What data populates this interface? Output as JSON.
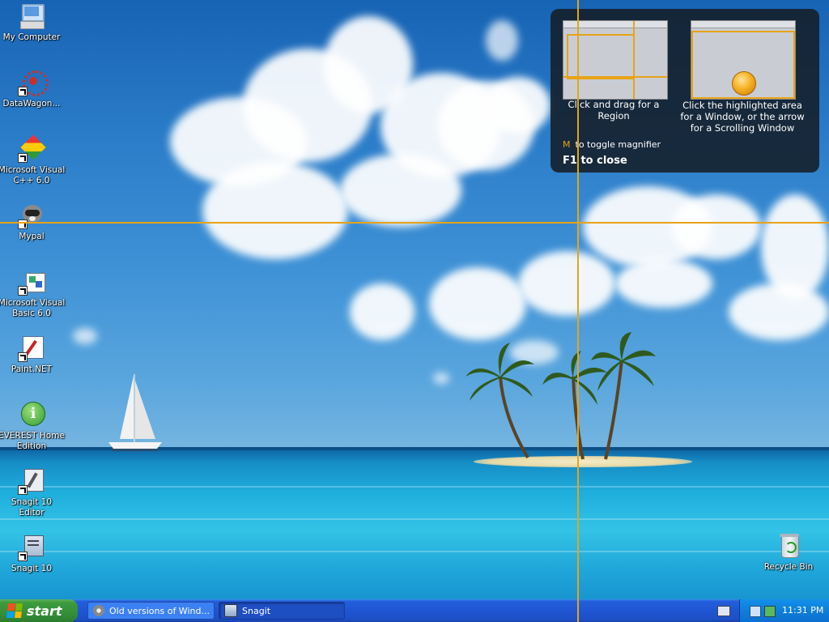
{
  "desktop": {
    "icons": [
      {
        "label": "My Computer",
        "icon": "my-computer-icon"
      },
      {
        "label": "DataWagon...",
        "icon": "datawagon-icon"
      },
      {
        "label": "Microsoft Visual C++ 6.0",
        "icon": "visual-cpp-icon"
      },
      {
        "label": "Mypal",
        "icon": "mypal-icon"
      },
      {
        "label": "Microsoft Visual Basic 6.0",
        "icon": "visual-basic-icon"
      },
      {
        "label": "Paint.NET",
        "icon": "paint-net-icon"
      },
      {
        "label": "EVEREST Home Edition",
        "icon": "everest-icon"
      },
      {
        "label": "Snagit 10 Editor",
        "icon": "snagit-editor-icon"
      },
      {
        "label": "Snagit 10",
        "icon": "snagit-icon"
      }
    ],
    "recycle_bin": {
      "label": "Recycle Bin",
      "icon": "recycle-bin-icon"
    }
  },
  "snagit_overlay": {
    "region_hint": "Click and drag for a Region",
    "window_hint": "Click the highlighted area for a Window, or the arrow for a Scrolling Window",
    "magnifier_key": "M",
    "magnifier_hint": "to toggle magnifier",
    "close_hint": "F1 to close",
    "accent_color": "#e8a317"
  },
  "taskbar": {
    "start_label": "start",
    "tasks": [
      {
        "label": "Old versions of Wind...",
        "icon": "mypal-icon"
      },
      {
        "label": "Snagit",
        "icon": "snagit-icon"
      }
    ],
    "clock": "11:31 PM"
  }
}
